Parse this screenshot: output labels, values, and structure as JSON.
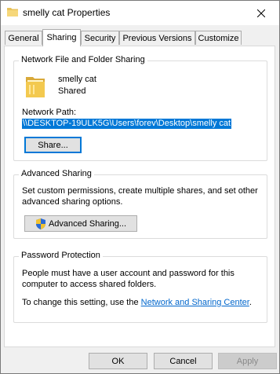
{
  "window": {
    "title": "smelly cat Properties",
    "icon": "folder-icon"
  },
  "tabs": [
    {
      "label": "General",
      "active": false
    },
    {
      "label": "Sharing",
      "active": true
    },
    {
      "label": "Security",
      "active": false
    },
    {
      "label": "Previous Versions",
      "active": false
    },
    {
      "label": "Customize",
      "active": false
    }
  ],
  "network_sharing": {
    "group_title": "Network File and Folder Sharing",
    "folder_name": "smelly cat",
    "folder_status": "Shared",
    "path_label": "Network Path:",
    "path_value": "\\\\DESKTOP-19ULK5G\\Users\\forev\\Desktop\\smelly cat",
    "share_button": "Share..."
  },
  "advanced_sharing": {
    "group_title": "Advanced Sharing",
    "description_line1": "Set custom permissions, create multiple shares, and set other",
    "description_line2": "advanced sharing options.",
    "button": "Advanced Sharing...",
    "button_icon": "uac-shield-icon"
  },
  "password_protection": {
    "group_title": "Password Protection",
    "line1": "People must have a user account and password for this",
    "line2": "computer to access shared folders.",
    "line3_prefix": "To change this setting, use the ",
    "link": "Network and Sharing Center",
    "line3_suffix": "."
  },
  "footer": {
    "ok": "OK",
    "cancel": "Cancel",
    "apply": "Apply"
  },
  "colors": {
    "accent": "#0078d7",
    "folder": "#e8c25a",
    "link": "#0066cc"
  }
}
